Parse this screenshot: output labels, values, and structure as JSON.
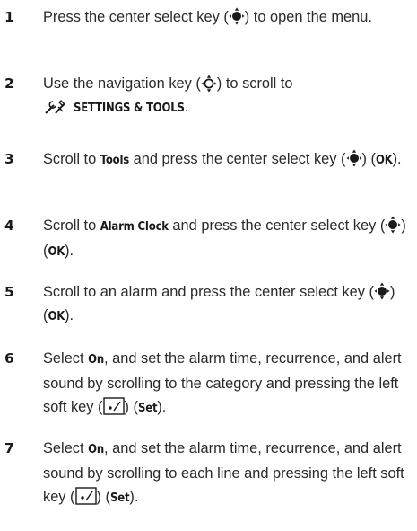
{
  "steps": [
    {
      "number": "1",
      "t1": "Press the center select key (",
      "icon1": "center-select-key-icon",
      "t2": ") to open the menu."
    },
    {
      "number": "2",
      "t1": "Use the navigation key (",
      "icon1": "navigation-key-icon",
      "t2": ") to scroll to",
      "icon2": "settings-tools-icon",
      "kw1": "SETTINGS & TOOLS",
      "t3": "."
    },
    {
      "number": "3",
      "t1": "Scroll to ",
      "kw1": "Tools",
      "t2": " and press the center select key (",
      "icon1": "center-select-key-icon",
      "t3": ") (",
      "kw2": "OK",
      "t4": ")."
    },
    {
      "number": "4",
      "t1": "Scroll to ",
      "kw1": "Alarm Clock",
      "t2": " and press the center select key (",
      "icon1": "center-select-key-icon",
      "t3": ") (",
      "kw2": "OK",
      "t4": ")."
    },
    {
      "number": "5",
      "t1": "Scroll to an alarm and press the center select key (",
      "icon1": "center-select-key-icon",
      "t2": ") (",
      "kw1": "OK",
      "t3": ")."
    },
    {
      "number": "6",
      "t1": "Select ",
      "kw1": "On",
      "t2": ", and set the alarm time, recurrence, and alert sound by scrolling to the category and pressing the left soft key (",
      "icon1": "left-soft-key-icon",
      "t3": ") (",
      "kw2": "Set",
      "t4": ")."
    },
    {
      "number": "7",
      "t1": "Select ",
      "kw1": "On",
      "t2": ", and set the alarm time, recurrence, and alert sound by scrolling to each line and pressing the left soft key (",
      "icon1": "left-soft-key-icon",
      "t3": ") (",
      "kw2": "Set",
      "t4": ")."
    }
  ]
}
